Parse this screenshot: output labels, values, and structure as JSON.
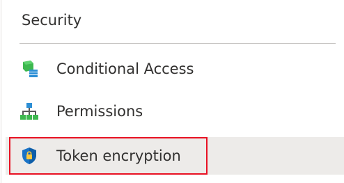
{
  "security": {
    "header": "Security",
    "items": [
      {
        "label": "Conditional Access",
        "icon": "conditional-access-icon"
      },
      {
        "label": "Permissions",
        "icon": "permissions-icon"
      },
      {
        "label": "Token encryption",
        "icon": "shield-lock-icon",
        "selected": true
      }
    ]
  },
  "colors": {
    "selected_background": "#edebe9",
    "highlight_border": "#e81123",
    "text": "#323130",
    "divider": "#c8c6c4"
  }
}
